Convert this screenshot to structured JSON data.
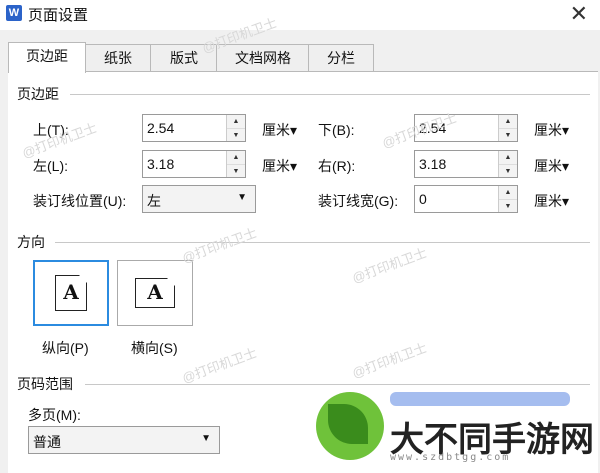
{
  "window": {
    "title": "页面设置",
    "app_icon_letter": "W",
    "close_glyph": "✕"
  },
  "tabs": [
    "页边距",
    "纸张",
    "版式",
    "文档网格",
    "分栏"
  ],
  "margins": {
    "section_label": "页边距",
    "top": {
      "label": "上(T):",
      "value": "2.54",
      "unit": "厘米▾"
    },
    "bottom": {
      "label": "下(B):",
      "value": "2.54",
      "unit": "厘米▾"
    },
    "left": {
      "label": "左(L):",
      "value": "3.18",
      "unit": "厘米▾"
    },
    "right": {
      "label": "右(R):",
      "value": "3.18",
      "unit": "厘米▾"
    },
    "gutter_pos": {
      "label": "装订线位置(U):",
      "value": "左"
    },
    "gutter_width": {
      "label": "装订线宽(G):",
      "value": "0",
      "unit": "厘米▾"
    }
  },
  "orientation": {
    "section_label": "方向",
    "portrait": {
      "label": "纵向(P)",
      "glyph": "A",
      "selected": true
    },
    "landscape": {
      "label": "横向(S)",
      "glyph": "A",
      "selected": false
    }
  },
  "pages": {
    "section_label": "页码范围",
    "multi_label": "多页(M):",
    "multi_value": "普通"
  },
  "watermark": {
    "text": "@打印机卫士",
    "logo_text": "大不同手游网",
    "logo_url": "www.szdbtgg.com"
  },
  "colors": {
    "accent": "#2b8be0",
    "title_bg": "#ffffff",
    "panel_bg": "#ffffff"
  }
}
